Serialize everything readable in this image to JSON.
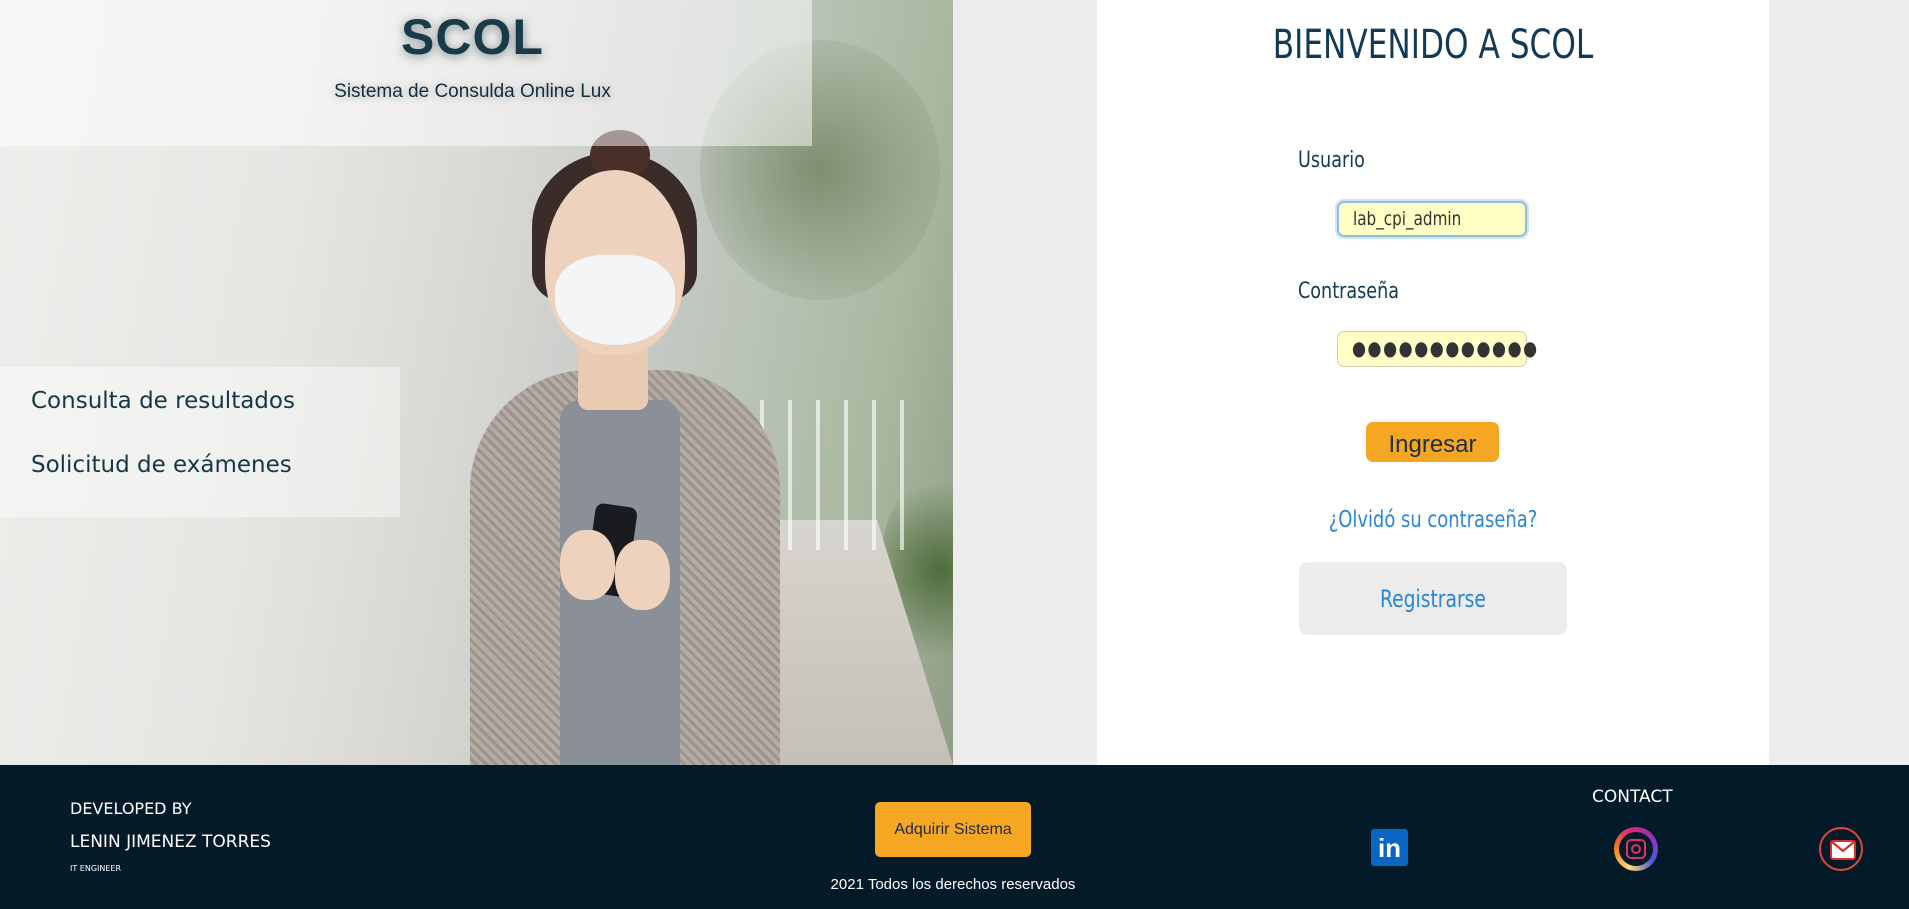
{
  "brand": {
    "title": "SCOL",
    "subtitle": "Sistema de Consulda Online Lux"
  },
  "menu": {
    "items": [
      {
        "label": "Consulta de resultados"
      },
      {
        "label": "Solicitud de exámenes"
      }
    ]
  },
  "login": {
    "welcome": "BIENVENIDO A SCOL",
    "username_label": "Usuario",
    "username_value": "lab_cpi_admin",
    "password_label": "Contraseña",
    "password_mask": "●●●●●●●●●●●●",
    "submit_label": "Ingresar",
    "forgot_link": "¿Olvidó su contraseña?",
    "register_label": "Registrarse"
  },
  "footer": {
    "developed_by": "DEVELOPED BY",
    "developer_name": "LENIN JIMENEZ TORRES",
    "developer_role": "IT ENGINEER",
    "acquire_button": "Adquirir Sistema",
    "rights": "2021 Todos los derechos reservados",
    "contact_title": "CONTACT",
    "social": [
      {
        "icon": "linkedin-icon",
        "glyph": "in"
      },
      {
        "icon": "instagram-icon"
      },
      {
        "icon": "gmail-icon"
      }
    ]
  },
  "colors": {
    "accent": "#f5a623",
    "footer_bg": "#031a28",
    "link": "#2a86d6",
    "heading": "#123a56",
    "input_bg": "#fffec4"
  }
}
